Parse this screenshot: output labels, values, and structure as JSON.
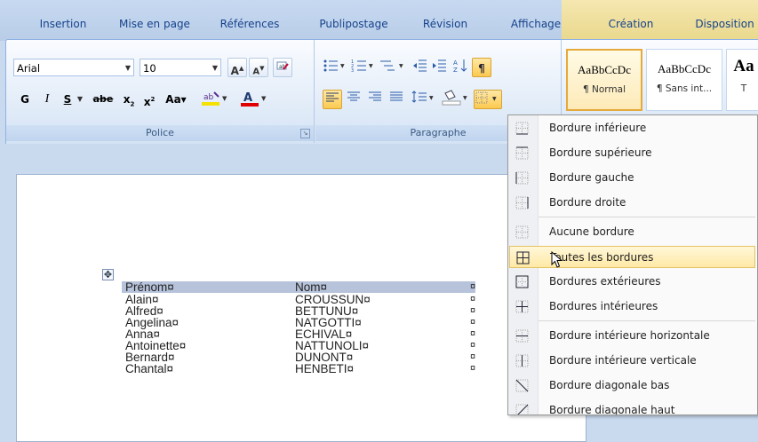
{
  "tabs": [
    "Insertion",
    "Mise en page",
    "Références",
    "Publipostage",
    "Révision",
    "Affichage",
    "Création",
    "Disposition"
  ],
  "font": {
    "name": "Arial",
    "size": "10",
    "group_label": "Police",
    "bold_label": "G",
    "italic_label": "I",
    "underline_label": "S",
    "strike_label": "abe"
  },
  "paragraph": {
    "group_label": "Paragraphe"
  },
  "styles": [
    {
      "sample": "AaBbCcDc",
      "name": "¶ Normal",
      "active": true
    },
    {
      "sample": "AaBbCcDc",
      "name": "¶ Sans int...",
      "active": false
    },
    {
      "sample": "Aa",
      "name": "T",
      "active": false
    }
  ],
  "table": {
    "header": [
      "Prénom¤",
      "Nom¤"
    ],
    "rows": [
      [
        "Alain¤",
        "CROUSSUN¤"
      ],
      [
        "Alfred¤",
        "BETTUNU¤"
      ],
      [
        "Angelina¤",
        "NATGOTTI¤"
      ],
      [
        "Anna¤",
        "ECHIVAL¤"
      ],
      [
        "Antoinette¤",
        "NATTUNOLI¤"
      ],
      [
        "Bernard¤",
        "DUNONT¤"
      ],
      [
        "Chantal¤",
        "HENBETI¤"
      ]
    ],
    "end_mark": "¤"
  },
  "border_menu": [
    {
      "label": "Bordure inférieure",
      "icon": "border-bottom-icon"
    },
    {
      "label": "Bordure supérieure",
      "icon": "border-top-icon"
    },
    {
      "label": "Bordure gauche",
      "icon": "border-left-icon"
    },
    {
      "label": "Bordure droite",
      "icon": "border-right-icon"
    },
    {
      "label": "Aucune bordure",
      "icon": "no-border-icon"
    },
    {
      "label": "Toutes les bordures",
      "icon": "all-borders-icon",
      "highlighted": true
    },
    {
      "label": "Bordures extérieures",
      "icon": "outside-borders-icon"
    },
    {
      "label": "Bordures intérieures",
      "icon": "inside-borders-icon"
    },
    {
      "label": "Bordure intérieure horizontale",
      "icon": "inside-horizontal-border-icon"
    },
    {
      "label": "Bordure intérieure verticale",
      "icon": "inside-vertical-border-icon"
    },
    {
      "label": "Bordure diagonale bas",
      "icon": "diagonal-down-border-icon"
    },
    {
      "label": "Bordure diagonale haut",
      "icon": "diagonal-up-border-icon"
    }
  ],
  "colors": {
    "ribbon_text": "#15428b",
    "menu_highlight": "#ffe9a6",
    "table_header": "#b7c3db",
    "highlighter": "#f5e100",
    "font_color": "#e00000"
  }
}
